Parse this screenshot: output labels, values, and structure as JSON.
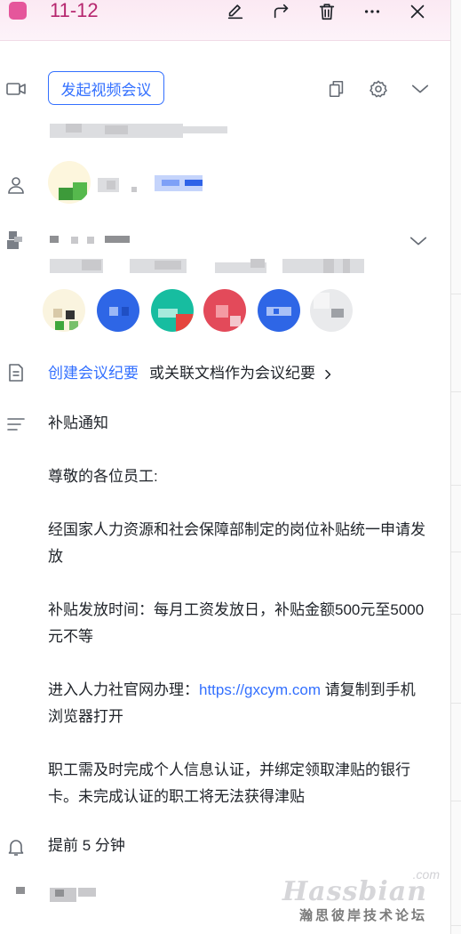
{
  "header": {
    "title": "11-12",
    "accent_color": "#e5569b",
    "actions": [
      "edit-icon",
      "share-icon",
      "delete-icon",
      "more-icon",
      "close-icon"
    ]
  },
  "meeting": {
    "video_button_label": "发起视频会议",
    "actions": [
      "copy-icon",
      "settings-icon",
      "chevron-down-icon"
    ]
  },
  "minutes": {
    "create_label": "创建会议纪要",
    "link_doc_label": "或关联文档作为会议纪要"
  },
  "description": {
    "title": "补贴通知",
    "greeting": "尊敬的各位员工:",
    "para1": "经国家人力资源和社会保障部制定的岗位补贴统一申请发放",
    "para2": "补贴发放时间：每月工资发放日，补贴金额500元至5000元不等",
    "para3_prefix": "进入人力社官网办理：",
    "para3_link": "https://gxcym.com",
    "para3_suffix": " 请复制到手机浏览器打开",
    "para4": "职工需及时完成个人信息认证，并绑定领取津贴的银行卡。未完成认证的职工将无法获得津贴"
  },
  "reminder": {
    "label": "提前 5 分钟"
  },
  "watermark": {
    "brand": "Hassbian",
    "suffix": ".com",
    "subtitle": "瀚思彼岸技术论坛"
  }
}
